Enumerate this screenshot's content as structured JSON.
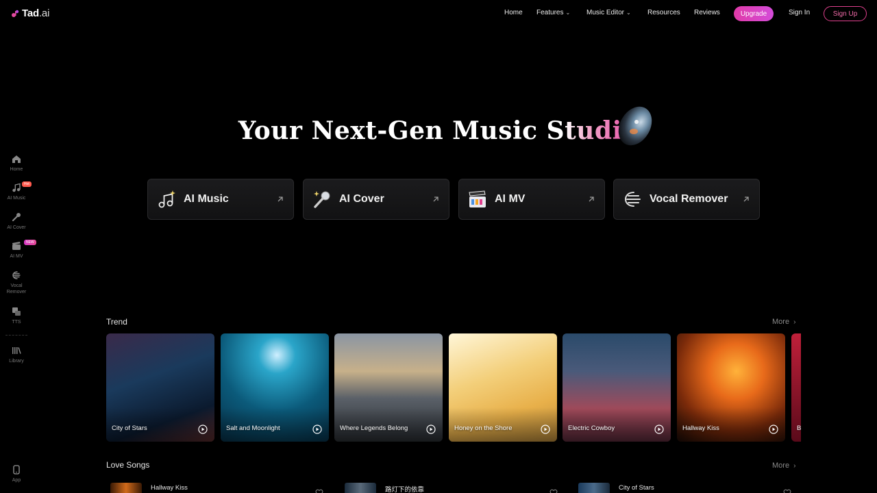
{
  "brand": {
    "name": "Tad",
    "suffix": ".ai",
    "accent": "#e03aa8"
  },
  "nav": {
    "home": "Home",
    "features": "Features",
    "music_editor": "Music Editor",
    "resources": "Resources",
    "reviews": "Reviews",
    "upgrade": "Upgrade",
    "sign_in": "Sign In",
    "sign_up": "Sign Up"
  },
  "sidebar": {
    "items": [
      {
        "label": "Home",
        "icon": "home-icon"
      },
      {
        "label": "AI Music",
        "icon": "music-note-icon",
        "badge": "Hot"
      },
      {
        "label": "AI Cover",
        "icon": "microphone-icon"
      },
      {
        "label": "AI MV",
        "icon": "clapperboard-icon",
        "badge": "NEW"
      },
      {
        "label": "Vocal Remover",
        "icon": "vocal-remover-icon"
      },
      {
        "label": "TTS",
        "icon": "tts-icon"
      },
      {
        "label": "Library",
        "icon": "library-icon"
      }
    ],
    "app": {
      "label": "App",
      "icon": "phone-icon"
    }
  },
  "hero": {
    "title_plain": "Your Next-Gen Music S",
    "title_grad": "tudio"
  },
  "features": [
    {
      "label": "AI Music",
      "icon": "music-sparkle-icon"
    },
    {
      "label": "AI Cover",
      "icon": "microphone-sparkle-icon"
    },
    {
      "label": "AI MV",
      "icon": "clapperboard-icon"
    },
    {
      "label": "Vocal Remover",
      "icon": "vocal-remover-icon"
    }
  ],
  "trend": {
    "title": "Trend",
    "more": "More",
    "cards": [
      {
        "title": "City of Stars"
      },
      {
        "title": "Salt and Moonlight"
      },
      {
        "title": "Where Legends Belong"
      },
      {
        "title": "Honey on the Shore"
      },
      {
        "title": "Electric Cowboy"
      },
      {
        "title": "Hallway Kiss"
      },
      {
        "title": "B"
      }
    ]
  },
  "love_songs": {
    "title": "Love Songs",
    "more": "More",
    "items": [
      {
        "title": "Hallway Kiss"
      },
      {
        "title": "路灯下的依靠"
      },
      {
        "title": "City of Stars"
      }
    ]
  }
}
